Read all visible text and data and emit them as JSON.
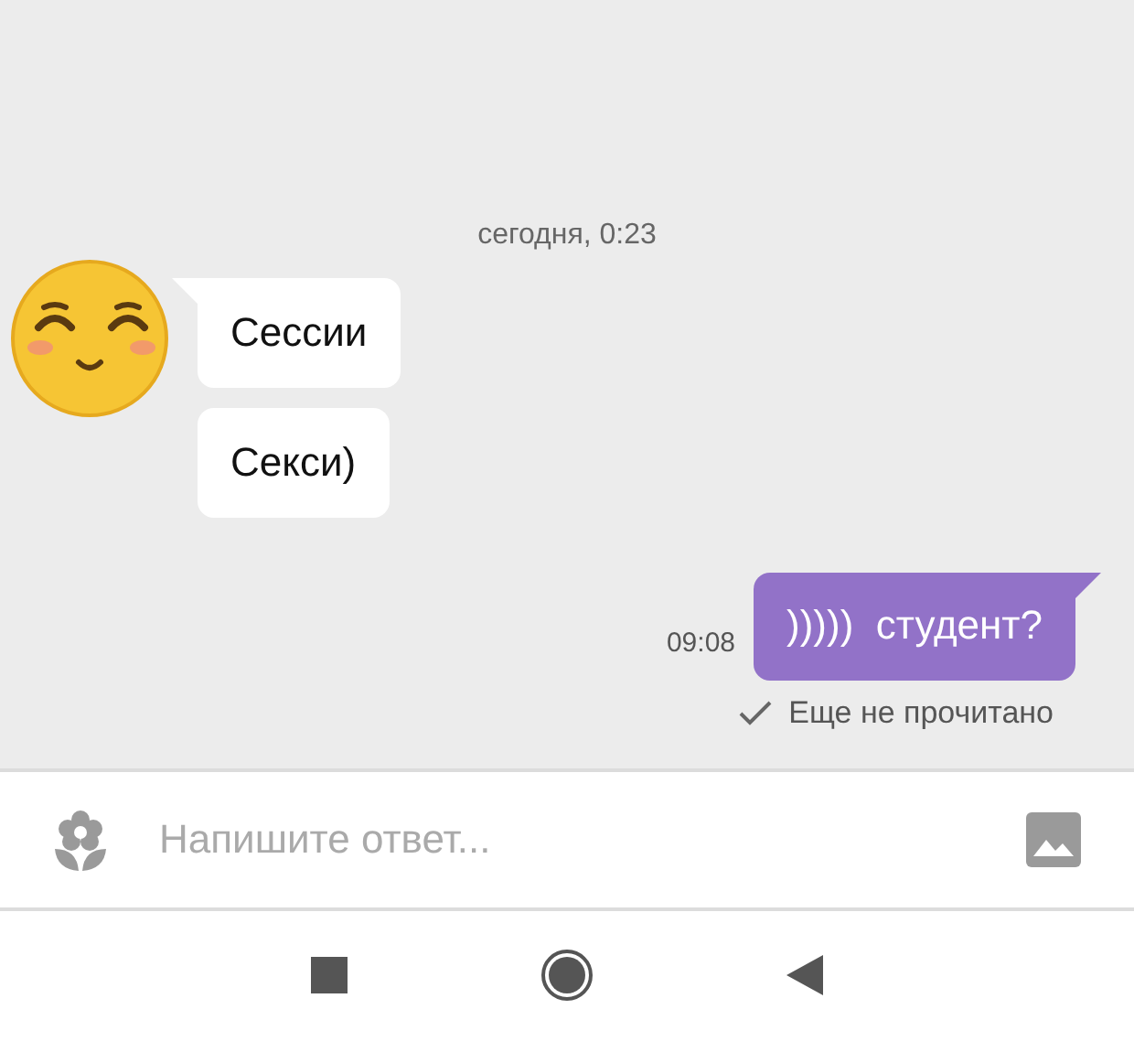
{
  "date_label": "сегодня, 0:23",
  "messages": [
    {
      "kind": "incoming",
      "text": "Сессии",
      "avatar": true
    },
    {
      "kind": "incoming",
      "text": "Секси)",
      "avatar": false
    },
    {
      "kind": "outgoing",
      "text": ")))))  студент?",
      "time": "09:08",
      "status": "Еще не прочитано"
    }
  ],
  "composer": {
    "placeholder": "Напишите ответ..."
  }
}
